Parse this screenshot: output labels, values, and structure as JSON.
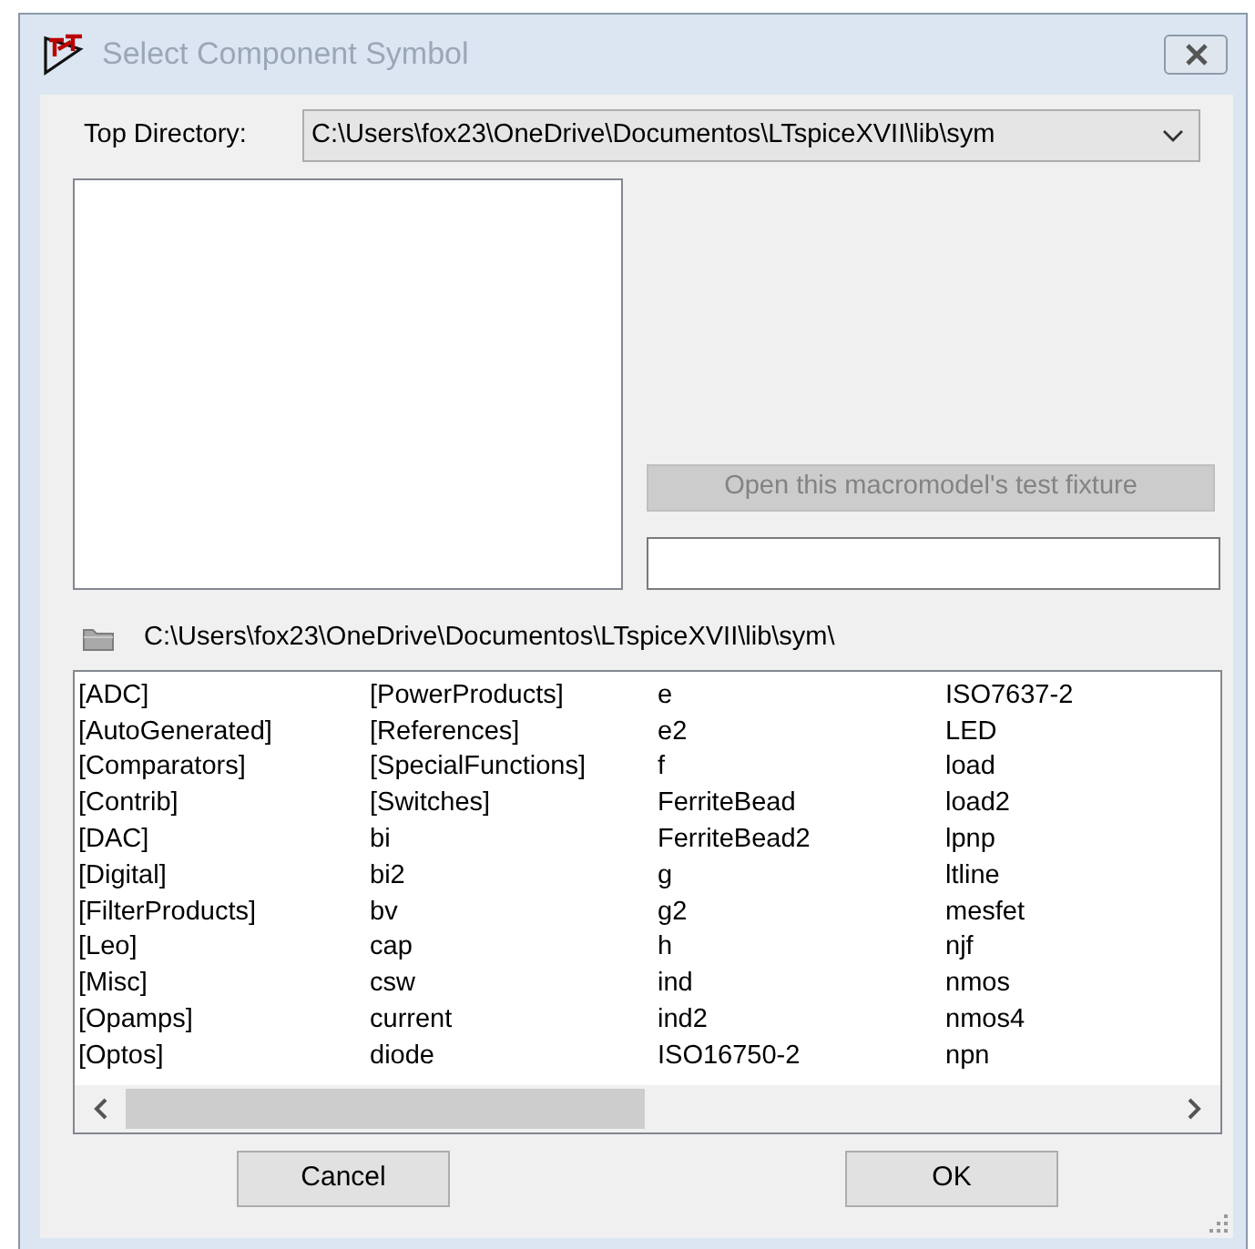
{
  "window": {
    "title": "Select Component Symbol",
    "active": false
  },
  "top_directory": {
    "label": "Top Directory:",
    "value": "C:\\Users\\fox23\\OneDrive\\Documentos\\LTspiceXVII\\lib\\sym"
  },
  "test_fixture_button": {
    "label": "Open this macromodel's test fixture",
    "disabled": true
  },
  "current_path": "C:\\Users\\fox23\\OneDrive\\Documentos\\LTspiceXVII\\lib\\sym\\",
  "file_list": {
    "columns": [
      [
        "[ADC]",
        "[AutoGenerated]",
        "[Comparators]",
        "[Contrib]",
        "[DAC]",
        "[Digital]",
        "[FilterProducts]",
        "[Leo]",
        "[Misc]",
        "[Opamps]",
        "[Optos]"
      ],
      [
        "[PowerProducts]",
        "[References]",
        "[SpecialFunctions]",
        "[Switches]",
        "bi",
        "bi2",
        "bv",
        "cap",
        "csw",
        "current",
        "diode"
      ],
      [
        "e",
        "e2",
        "f",
        "FerriteBead",
        "FerriteBead2",
        "g",
        "g2",
        "h",
        "ind",
        "ind2",
        "ISO16750-2"
      ],
      [
        "ISO7637-2",
        "LED",
        "load",
        "load2",
        "lpnp",
        "ltline",
        "mesfet",
        "njf",
        "nmos",
        "nmos4",
        "npn"
      ]
    ]
  },
  "buttons": [
    {
      "label": "Cancel"
    },
    {
      "label": "OK"
    }
  ]
}
